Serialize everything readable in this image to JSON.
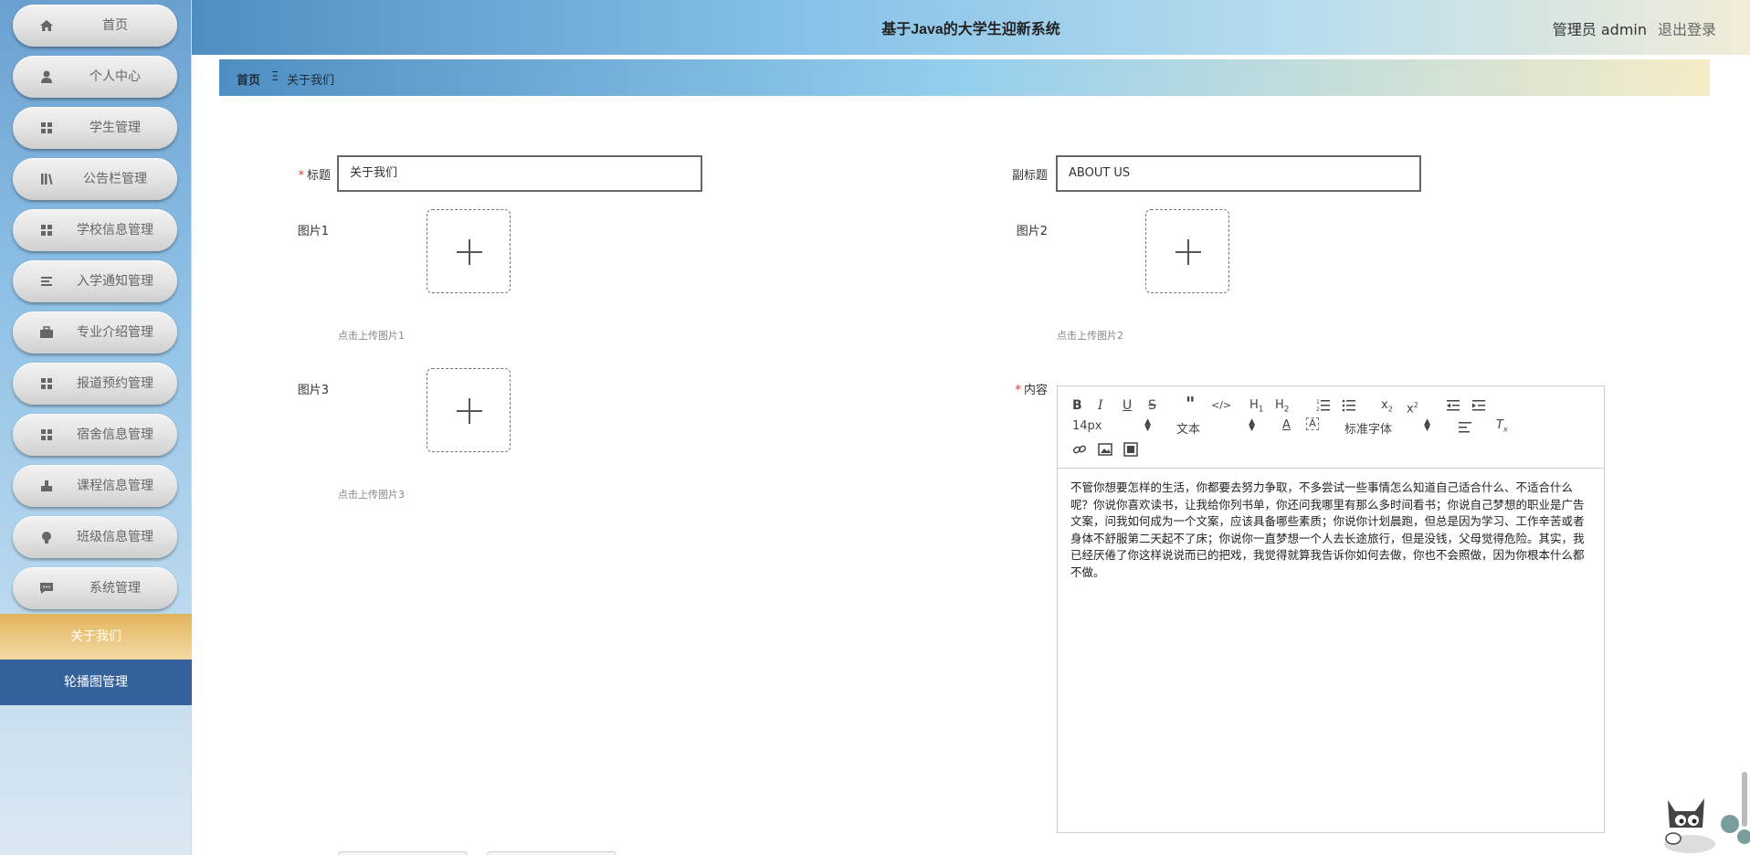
{
  "app": {
    "title": "基于Java的大学生迎新系统",
    "user_label": "管理员 admin",
    "logout_label": "退出登录"
  },
  "sidebar": {
    "items": [
      {
        "label": "首页",
        "icon": "home-icon"
      },
      {
        "label": "个人中心",
        "icon": "user-icon"
      },
      {
        "label": "学生管理",
        "icon": "grid-icon"
      },
      {
        "label": "公告栏管理",
        "icon": "library-icon"
      },
      {
        "label": "学校信息管理",
        "icon": "grid-icon"
      },
      {
        "label": "入学通知管理",
        "icon": "list-icon"
      },
      {
        "label": "专业介绍管理",
        "icon": "briefcase-icon"
      },
      {
        "label": "报道预约管理",
        "icon": "grid-icon"
      },
      {
        "label": "宿舍信息管理",
        "icon": "grid-icon"
      },
      {
        "label": "课程信息管理",
        "icon": "stamp-icon"
      },
      {
        "label": "班级信息管理",
        "icon": "bulb-icon"
      },
      {
        "label": "系统管理",
        "icon": "chat-icon"
      }
    ],
    "active_item": "关于我们",
    "extra_item": "轮播图管理"
  },
  "breadcrumb": {
    "home": "首页",
    "separator": "Ξ",
    "current": "关于我们"
  },
  "form": {
    "title_label": "标题",
    "title_value": "关于我们",
    "subtitle_label": "副标题",
    "subtitle_value": "ABOUT US",
    "image1_label": "图片1",
    "image1_hint": "点击上传图片1",
    "image2_label": "图片2",
    "image2_hint": "点击上传图片2",
    "image3_label": "图片3",
    "image3_hint": "点击上传图片3",
    "content_label": "内容",
    "required_mark": "*"
  },
  "editor": {
    "font_size": "14px",
    "text_style": "文本",
    "font_family": "标准字体",
    "content": "不管你想要怎样的生活，你都要去努力争取，不多尝试一些事情怎么知道自己适合什么、不适合什么呢？你说你喜欢读书，让我给你列书单，你还问我哪里有那么多时间看书；你说自己梦想的职业是广告文案，问我如何成为一个文案，应该具备哪些素质；你说你计划晨跑，但总是因为学习、工作辛苦或者身体不舒服第二天起不了床；你说你一直梦想一个人去长途旅行，但是没钱，父母觉得危险。其实，我已经厌倦了你这样说说而已的把戏，我觉得就算我告诉你如何去做，你也不会照做，因为你根本什么都不做。"
  },
  "colors": {
    "sidebar_active": "#e3b45d",
    "sidebar_carousel": "#34619b",
    "required": "#ee3333"
  }
}
